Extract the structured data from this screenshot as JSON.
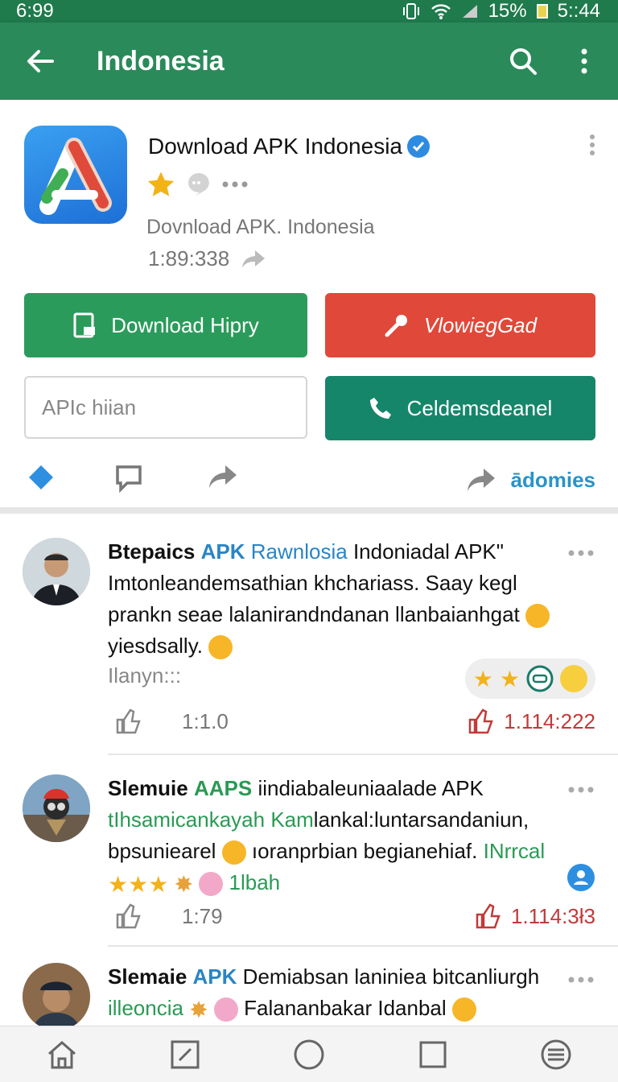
{
  "status_bar": {
    "time_left": "6:99",
    "battery": "15%",
    "time_right": "5::44"
  },
  "app_bar": {
    "title": "Indonesia"
  },
  "card": {
    "name": "Download APK Indonesia",
    "subtitle": "Dovnload APK. Indonesia",
    "count": "1:89:338",
    "btn_download": "Download Hipry",
    "btn_red": "VlowiegGad",
    "input_placeholder": "APIc hiian",
    "btn_teal": "Celdemsdeanel",
    "link": "ādomies"
  },
  "comments": [
    {
      "name": "Btepaics",
      "tag": "APK",
      "source": "Rawnlosia",
      "text_1": "Indoniadal APK\"",
      "text_2": "Imtonleandemsathian khchariass. Saay kegl",
      "text_3": "prankn seae lalanirandndanan llanbaianhgat",
      "text_4": "yiesdsally.",
      "sub": "Ilanyn:::",
      "likes": "1:1.0",
      "dislikes": "1.114:222"
    },
    {
      "name": "Slemuie",
      "tag": "AAPS",
      "text_1": "iindiabaleuniaalade APK",
      "green_2": "tIhsamicankayah Kam",
      "text_2": "lankal:luntarsandaniun,",
      "text_3": "bpsuniearel",
      "text_3b": "ıoranprbian begianehiaf.",
      "tag_3": "INrrcal",
      "rating_text": "1lbah",
      "likes": "1:79",
      "dislikes": "1.114:3ł3"
    },
    {
      "name": "Slemaie",
      "tag": "APK",
      "text_1": "Demiabsan laniniea bitcanliurgh",
      "green_2": "illeoncia",
      "text_2": "Falananbakar Idanbal"
    }
  ],
  "colors": {
    "app_bar": "#2a8a5a",
    "status_bar": "#1f7a4c",
    "btn_green": "#2b9b5b",
    "btn_red": "#e0483a",
    "btn_teal": "#16866a",
    "link_blue": "#2a93c9"
  }
}
